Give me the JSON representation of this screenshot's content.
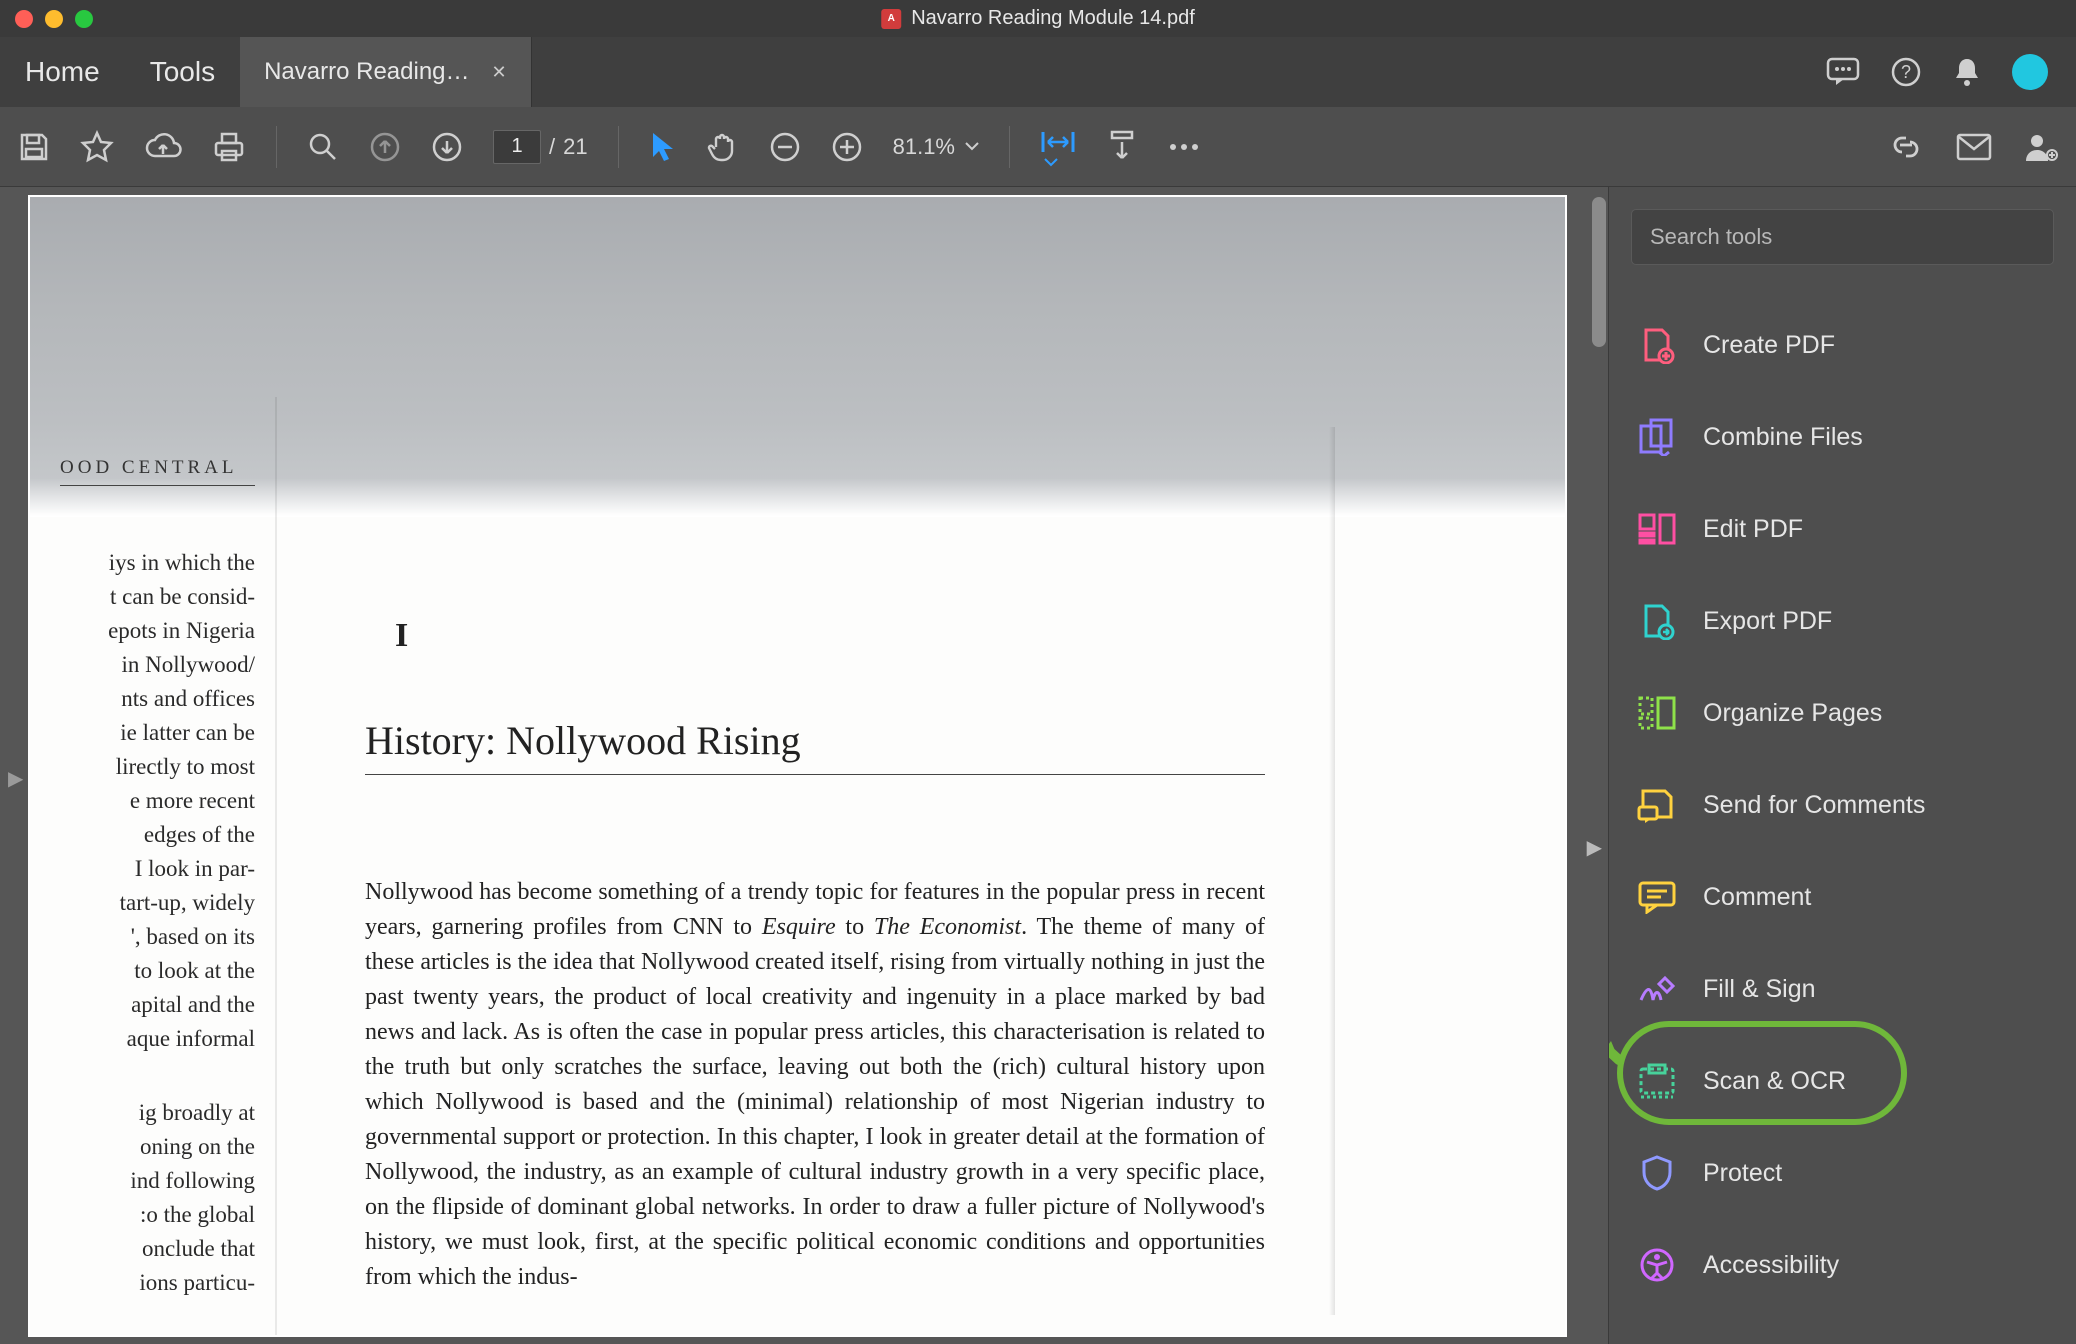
{
  "window": {
    "title": "Navarro Reading Module 14.pdf"
  },
  "nav": {
    "home": "Home",
    "tools": "Tools"
  },
  "tab": {
    "label": "Navarro Reading…"
  },
  "toolbar": {
    "page_current": "1",
    "page_sep": "/",
    "page_total": "21",
    "zoom": "81.1%"
  },
  "search": {
    "placeholder": "Search tools"
  },
  "tools": [
    {
      "label": "Create PDF",
      "icon": "create-pdf-icon",
      "color": "#ff5e7e"
    },
    {
      "label": "Combine Files",
      "icon": "combine-files-icon",
      "color": "#8f7cff"
    },
    {
      "label": "Edit PDF",
      "icon": "edit-pdf-icon",
      "color": "#ff4fa3"
    },
    {
      "label": "Export PDF",
      "icon": "export-pdf-icon",
      "color": "#2fd3cf"
    },
    {
      "label": "Organize Pages",
      "icon": "organize-pages-icon",
      "color": "#8fe24a"
    },
    {
      "label": "Send for Comments",
      "icon": "send-comments-icon",
      "color": "#ffd23f"
    },
    {
      "label": "Comment",
      "icon": "comment-icon",
      "color": "#ffd23f"
    },
    {
      "label": "Fill & Sign",
      "icon": "fill-sign-icon",
      "color": "#b77cff"
    },
    {
      "label": "Scan & OCR",
      "icon": "scan-ocr-icon",
      "color": "#47d29b",
      "highlighted": true
    },
    {
      "label": "Protect",
      "icon": "protect-icon",
      "color": "#8f99ff"
    },
    {
      "label": "Accessibility",
      "icon": "accessibility-icon",
      "color": "#d067ff"
    }
  ],
  "book": {
    "running_head": "OOD CENTRAL",
    "left_frag_1": "iys in which the\nt can be consid-\nepots in Nigeria\n in Nollywood/\nnts and offices\nie latter can be\nlirectly to most\ne more recent\n edges of the\n I look in par-\ntart-up, widely\n', based on its\nto look at the\napital and the\naque informal",
    "left_frag_2": "ig broadly at\noning on the\nind following\n:o the global\nonclude that\nions particu-",
    "chapter_num": "I",
    "chapter_title": "History: Nollywood Rising",
    "para1_a": "Nollywood has become something of a trendy topic for features in the popular press in recent years, garnering profiles from CNN to ",
    "para1_i1": "Esquire",
    "para1_b": " to ",
    "para1_i2": "The Economist",
    "para1_c": ". The theme of many of these articles is the idea that Nollywood created itself, rising from virtually nothing in just the past twenty years, the product of local creativity and ingenuity in a place marked by bad news and lack. As is often the case in popular press articles, this characterisation is related to the truth but only scratches the surface, leaving out both the (rich) cultural history upon which Nollywood is based and the (minimal) relationship of most Nigerian industry to governmental support or protection. In this chapter, I look in greater detail at the formation of Nollywood, the industry, as an example of cultural industry growth in a very specific place, on the flipside of dominant global networks. In order to draw a fuller picture of Nollywood's history, we must look, first, at the specific political economic conditions and opportunities from which the indus-"
  }
}
